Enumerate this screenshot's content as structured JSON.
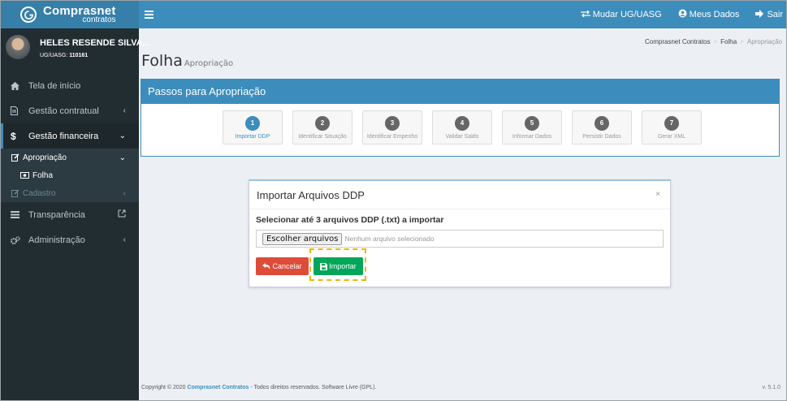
{
  "header": {
    "logo_main": "Comprasnet",
    "logo_sub": "contratos",
    "mudar_ug": "Mudar UG/UASG",
    "meus_dados": "Meus Dados",
    "sair": "Sair"
  },
  "user": {
    "name": "HELES RESENDE SILVA...",
    "ug_label": "UG/UASG:",
    "ug_value": "110161"
  },
  "sidebar": {
    "tela_inicio": "Tela de início",
    "gestao_contratual": "Gestão contratual",
    "gestao_financeira": "Gestão financeira",
    "apropriacao": "Apropriação",
    "folha": "Folha",
    "cadastro": "Cadastro",
    "transparencia": "Transparência",
    "administracao": "Administração"
  },
  "page": {
    "title": "Folha",
    "subtitle": "Apropriação",
    "breadcrumb": [
      "Comprasnet Contratos",
      "Folha",
      "Apropriação"
    ]
  },
  "steps": {
    "heading": "Passos para Apropriação",
    "items": [
      {
        "num": "1",
        "label": "Importar DDP"
      },
      {
        "num": "2",
        "label": "Identificar Situação"
      },
      {
        "num": "3",
        "label": "Identificar Empenho"
      },
      {
        "num": "4",
        "label": "Validar Saldo"
      },
      {
        "num": "5",
        "label": "Informar Dados"
      },
      {
        "num": "6",
        "label": "Persistir Dados"
      },
      {
        "num": "7",
        "label": "Gerar XML"
      }
    ]
  },
  "modal": {
    "title": "Importar Arquivos DDP",
    "close": "×",
    "label": "Selecionar até 3 arquivos DDP (.txt) a importar",
    "file_button": "Escolher arquivos",
    "file_status": "Nenhum arquivo selecionado",
    "cancel": "Cancelar",
    "import": "Importar"
  },
  "footer": {
    "prefix": "Copyright © 2020",
    "brand": "Comprasnet Contratos",
    "suffix": "- Todos direitos reservados. Software Livre (GPL).",
    "version": "v. 5.1.0"
  },
  "colors": {
    "primary": "#3c8dbc",
    "logo_bg": "#367fa9",
    "sidebar_bg": "#222d32",
    "danger": "#dd4b39",
    "success": "#00a65a",
    "highlight": "#f0b400"
  },
  "icons": [
    "logo-icon",
    "menu-icon",
    "swap-icon",
    "user-circle-icon",
    "sign-out-icon",
    "home-icon",
    "file-icon",
    "dollar-icon",
    "edit-icon",
    "money-icon",
    "list-icon",
    "external-link-icon",
    "cogs-icon",
    "undo-icon",
    "save-icon",
    "close-icon"
  ]
}
